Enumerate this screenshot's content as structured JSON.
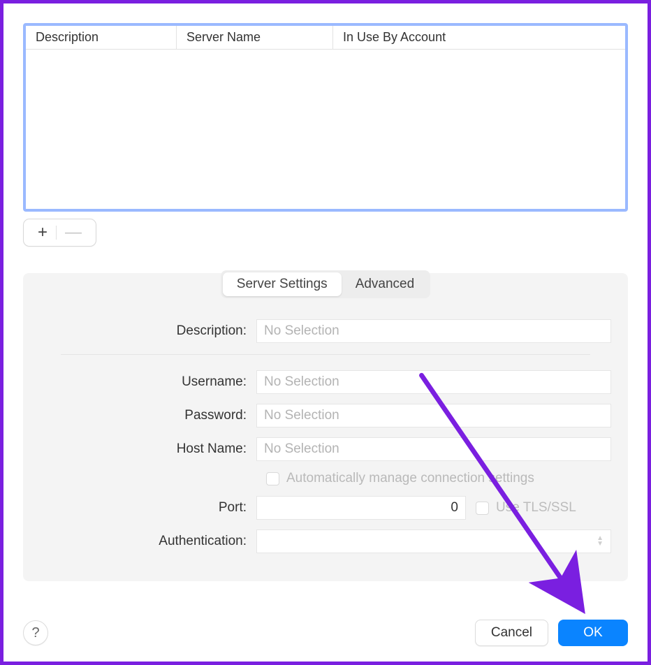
{
  "table": {
    "columns": {
      "description": "Description",
      "server_name": "Server Name",
      "in_use": "In Use By Account"
    },
    "rows": []
  },
  "addremove": {
    "add": "+",
    "remove": "—"
  },
  "tabs": {
    "server_settings": "Server Settings",
    "advanced": "Advanced"
  },
  "form": {
    "description_label": "Description:",
    "description_placeholder": "No Selection",
    "username_label": "Username:",
    "username_placeholder": "No Selection",
    "password_label": "Password:",
    "password_placeholder": "No Selection",
    "hostname_label": "Host Name:",
    "hostname_placeholder": "No Selection",
    "auto_manage_label": "Automatically manage connection settings",
    "port_label": "Port:",
    "port_value": "0",
    "tls_label": "Use TLS/SSL",
    "auth_label": "Authentication:",
    "auth_value": ""
  },
  "footer": {
    "help": "?",
    "cancel": "Cancel",
    "ok": "OK"
  },
  "annotation": {
    "arrow_color": "#7a1fe0"
  }
}
